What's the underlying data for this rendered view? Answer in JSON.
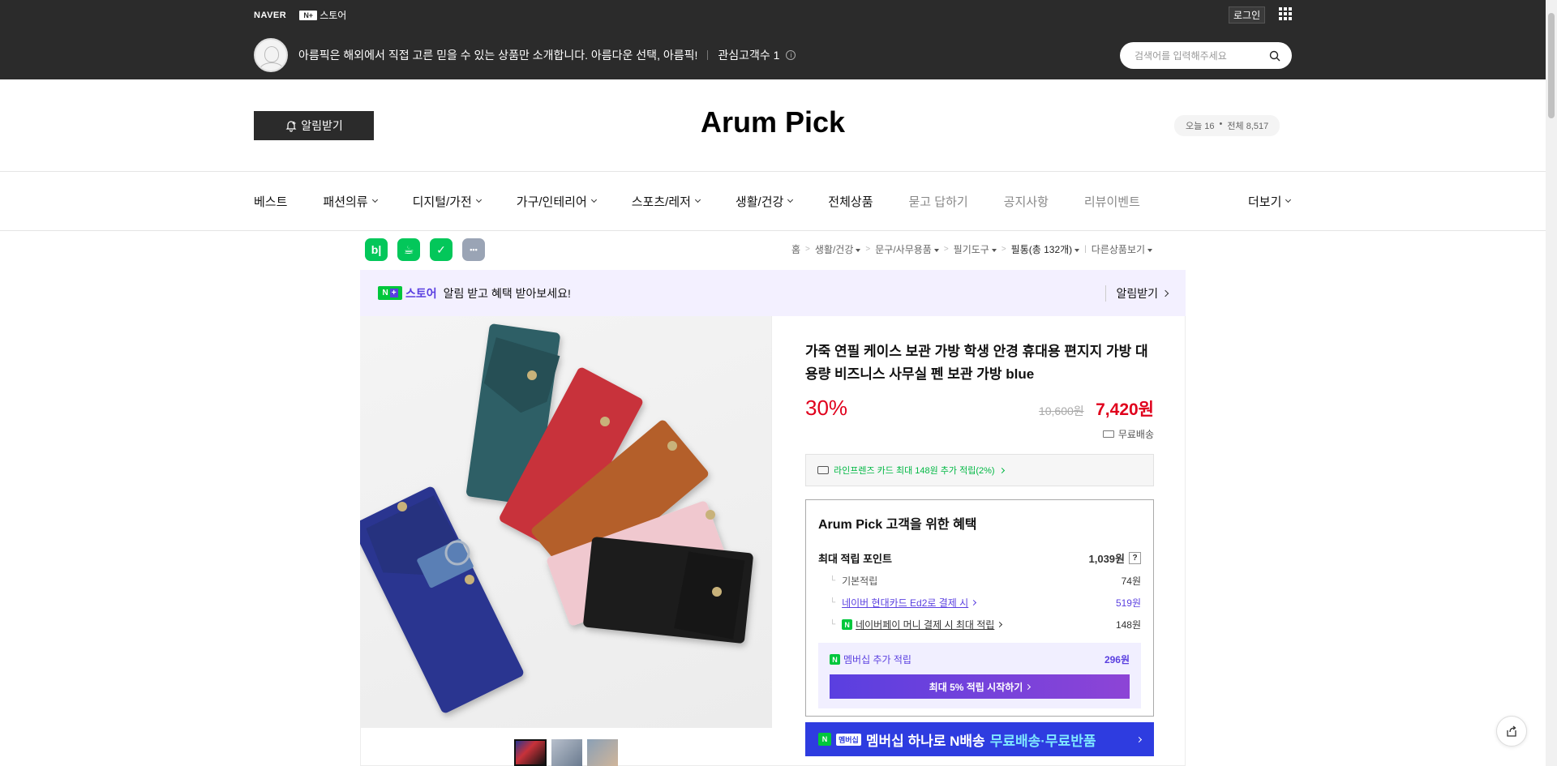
{
  "gnb": {
    "naver": "NAVER",
    "np_badge": "N+",
    "store": "스토어",
    "login": "로그인"
  },
  "seller": {
    "intro": "아름픽은 해외에서 직접 고른 믿을 수 있는 상품만 소개합니다. 아름다운 선택, 아름픽!",
    "fav_label": "관심고객수 1"
  },
  "search": {
    "placeholder": "검색어를 입력해주세요"
  },
  "header": {
    "alarm": "알림받기",
    "title": "Arum Pick",
    "today": "오늘 16",
    "total": "전체 8,517"
  },
  "categories": [
    {
      "label": "베스트",
      "caret": false,
      "gray": false
    },
    {
      "label": "패션의류",
      "caret": true,
      "gray": false
    },
    {
      "label": "디지털/가전",
      "caret": true,
      "gray": false
    },
    {
      "label": "가구/인테리어",
      "caret": true,
      "gray": false
    },
    {
      "label": "스포츠/레저",
      "caret": true,
      "gray": false
    },
    {
      "label": "생활/건강",
      "caret": true,
      "gray": false
    },
    {
      "label": "전체상품",
      "caret": false,
      "gray": false
    },
    {
      "label": "묻고 답하기",
      "caret": false,
      "gray": true
    },
    {
      "label": "공지사항",
      "caret": false,
      "gray": true
    },
    {
      "label": "리뷰이벤트",
      "caret": false,
      "gray": true
    }
  ],
  "more": "더보기",
  "share_icons": [
    {
      "name": "blog-share-icon",
      "glyph": "b|",
      "color": "#03c75a"
    },
    {
      "name": "cafe-share-icon",
      "glyph": "☕",
      "color": "#03c75a"
    },
    {
      "name": "bookmark-share-icon",
      "glyph": "✓",
      "color": "#03c75a"
    },
    {
      "name": "more-share-icon",
      "glyph": "•••",
      "color": "#9aa4b5"
    }
  ],
  "breadcrumb": {
    "home": "홈",
    "c1": "생활/건강",
    "c2": "문구/사무용품",
    "c3": "필기도구",
    "c4": "필통(총 132개)",
    "other": "다른상품보기"
  },
  "promo": {
    "np": "N",
    "plus": "+",
    "store": "스토어",
    "text": "알림 받고 혜택 받아보세요!",
    "action": "알림받기"
  },
  "product": {
    "title": "가죽 연필 케이스 보관 가방 학생 안경 휴대용 편지지 가방 대용량 비즈니스 사무실 펜 보관 가방 blue",
    "discount": "30%",
    "original_price": "10,600원",
    "sale_price": "7,420원",
    "shipping": "무료배송",
    "card_benefit": "라인프렌즈 카드 최대 148원 추가 적립(2%)"
  },
  "benefits": {
    "heading": "Arum Pick 고객을 위한 혜택",
    "max_label": "최대 적립 포인트",
    "max_value": "1,039원",
    "basic_label": "기본적립",
    "basic_value": "74원",
    "card_label": "네이버 현대카드 Ed2로 결제 시",
    "card_value": "519원",
    "pay_label": "네이버페이 머니 결제 시 최대 적립",
    "pay_value": "148원",
    "member_label": "멤버십 추가 적립",
    "member_value": "296원",
    "start_btn": "최대 5% 적립 시작하기"
  },
  "membership_banner": {
    "tag": "멤버십",
    "text1": "멤버십 하나로 N배송",
    "text2": "무료배송·무료반품"
  },
  "colors": {
    "accent": "#5a3fe0",
    "sale": "#e0001c",
    "green": "#03c75a",
    "dark": "#2b2b2b"
  },
  "product_image": {
    "cases": [
      "teal",
      "red",
      "brown",
      "pink",
      "black",
      "navy"
    ]
  }
}
